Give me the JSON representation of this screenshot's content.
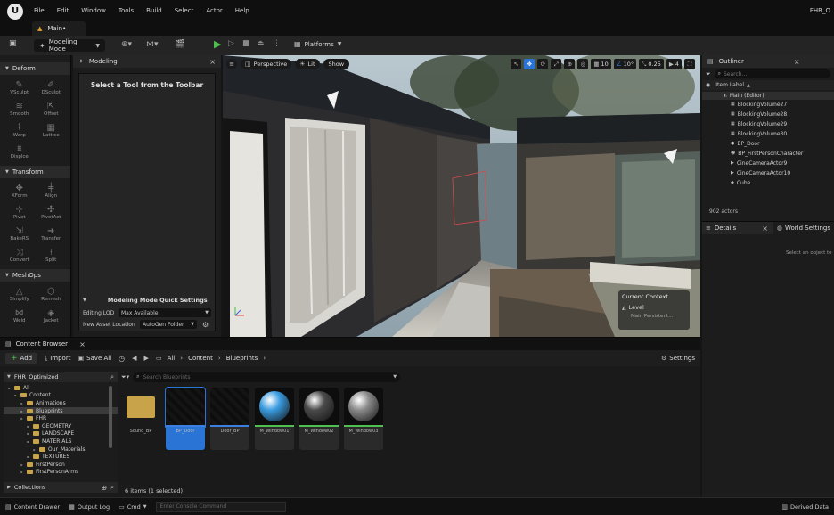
{
  "menubar": {
    "items": [
      "File",
      "Edit",
      "Window",
      "Tools",
      "Build",
      "Select",
      "Actor",
      "Help"
    ],
    "project_title": "FHR_O"
  },
  "level_tab": {
    "label": "Main•"
  },
  "toolbar": {
    "mode_label": "Modeling Mode",
    "platforms_label": "Platforms"
  },
  "deform_panel": {
    "sections": [
      {
        "title": "Deform",
        "tools": [
          "VSculpt",
          "DSculpt",
          "Smooth",
          "Offset",
          "Warp",
          "Lattice",
          "Displce"
        ]
      },
      {
        "title": "Transform",
        "tools": [
          "XForm",
          "Align",
          "Pivot",
          "PivotAct",
          "BakeRS",
          "Transfer",
          "Convert",
          "Split"
        ]
      },
      {
        "title": "MeshOps",
        "tools": [
          "Simplify",
          "Remesh",
          "Weld",
          "Jacket"
        ]
      }
    ]
  },
  "modeling_panel": {
    "tab_label": "Modeling",
    "prompt": "Select a Tool from the Toolbar",
    "quick_settings_title": "Modeling Mode Quick Settings",
    "editing_lod_label": "Editing LOD",
    "editing_lod_value": "Max Available",
    "new_asset_location_label": "New Asset Location",
    "new_asset_location_value": "AutoGen Folder"
  },
  "viewport": {
    "perspective_label": "Perspective",
    "lit_label": "Lit",
    "show_label": "Show",
    "grid_value": "10",
    "angle_value": "10°",
    "scale_value": "0.25",
    "camera_speed": "4",
    "context": {
      "title": "Current Context",
      "level_label": "Level",
      "level_value": "Main Persistent..."
    }
  },
  "outliner": {
    "tab_label": "Outliner",
    "search_placeholder": "Search...",
    "column_label": "Item Label",
    "root": "Main (Editor)",
    "items": [
      "BlockingVolume27",
      "BlockingVolume28",
      "BlockingVolume29",
      "BlockingVolume30",
      "BP_Door",
      "BP_FirstPersonCharacter",
      "CineCameraActor9",
      "CineCameraActor10",
      "Cube"
    ],
    "count_label": "902 actors"
  },
  "details": {
    "tab_label": "Details",
    "world_settings_label": "World Settings",
    "hint": "Select an object to"
  },
  "content_browser": {
    "tab_label": "Content Browser",
    "add_label": "Add",
    "import_label": "Import",
    "save_all_label": "Save All",
    "settings_label": "Settings",
    "path": [
      "All",
      "Content",
      "Blueprints"
    ],
    "project_label": "FHR_Optimized",
    "search_placeholder": "Search Blueprints",
    "tree": [
      {
        "label": "All",
        "depth": 0
      },
      {
        "label": "Content",
        "depth": 1
      },
      {
        "label": "Animations",
        "depth": 2
      },
      {
        "label": "Blueprints",
        "depth": 2,
        "selected": true
      },
      {
        "label": "FHR",
        "depth": 2
      },
      {
        "label": "GEOMETRY",
        "depth": 3
      },
      {
        "label": "LANDSCAPE",
        "depth": 3
      },
      {
        "label": "MATERIALS",
        "depth": 3
      },
      {
        "label": "Our_Materials",
        "depth": 4
      },
      {
        "label": "TEXTURES",
        "depth": 3
      },
      {
        "label": "FirstPerson",
        "depth": 2
      },
      {
        "label": "FirstPersonArms",
        "depth": 2
      }
    ],
    "assets": [
      {
        "name": "Sound_BP",
        "kind": "folder"
      },
      {
        "name": "BP_Door",
        "kind": "blueprint",
        "selected": true
      },
      {
        "name": "Door_BP",
        "kind": "blueprint"
      },
      {
        "name": "M_Window01",
        "kind": "material",
        "color": "#3a9be0"
      },
      {
        "name": "M_Window02",
        "kind": "material",
        "color": "#4a4a4a"
      },
      {
        "name": "M_Window03",
        "kind": "material",
        "color": "#8a8a8a"
      }
    ],
    "collections_label": "Collections",
    "selection_status": "6 items (1 selected)"
  },
  "statusbar": {
    "content_drawer_label": "Content Drawer",
    "output_log_label": "Output Log",
    "cmd_label": "Cmd",
    "console_placeholder": "Enter Console Command",
    "derived_data_label": "Derived Data"
  },
  "colors": {
    "accent_blue": "#2a74d6",
    "play_green": "#4fbf4f",
    "folder_gold": "#c9a349"
  }
}
